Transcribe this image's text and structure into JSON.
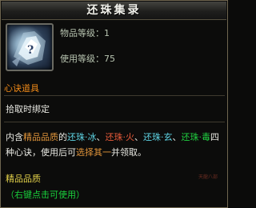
{
  "title": "还珠集录",
  "item": {
    "icon": "silver-pearl-icon",
    "level_label": "物品等级：1",
    "use_level_label": "使用等级：75"
  },
  "category": "心诀道具",
  "binding": "拾取时绑定",
  "description": {
    "part1": "内含",
    "quality": "精品品质",
    "part2": "的",
    "s1": "还珠·冰",
    "c1": "、",
    "s2": "还珠·火",
    "c2": "、",
    "s3": "还珠·玄",
    "c3": "、",
    "s4": "还珠·毒",
    "part3": "四种心诀，使用后可",
    "choose": "选择其一",
    "part4": "并领取。"
  },
  "quality_line": "精品品质",
  "hint": "（右键点击可使用）",
  "seal_text": "天龍八部",
  "colors": {
    "accent_orange": "#f08a18",
    "hint_green": "#19cf3b",
    "text_white": "#e8e8e2"
  }
}
